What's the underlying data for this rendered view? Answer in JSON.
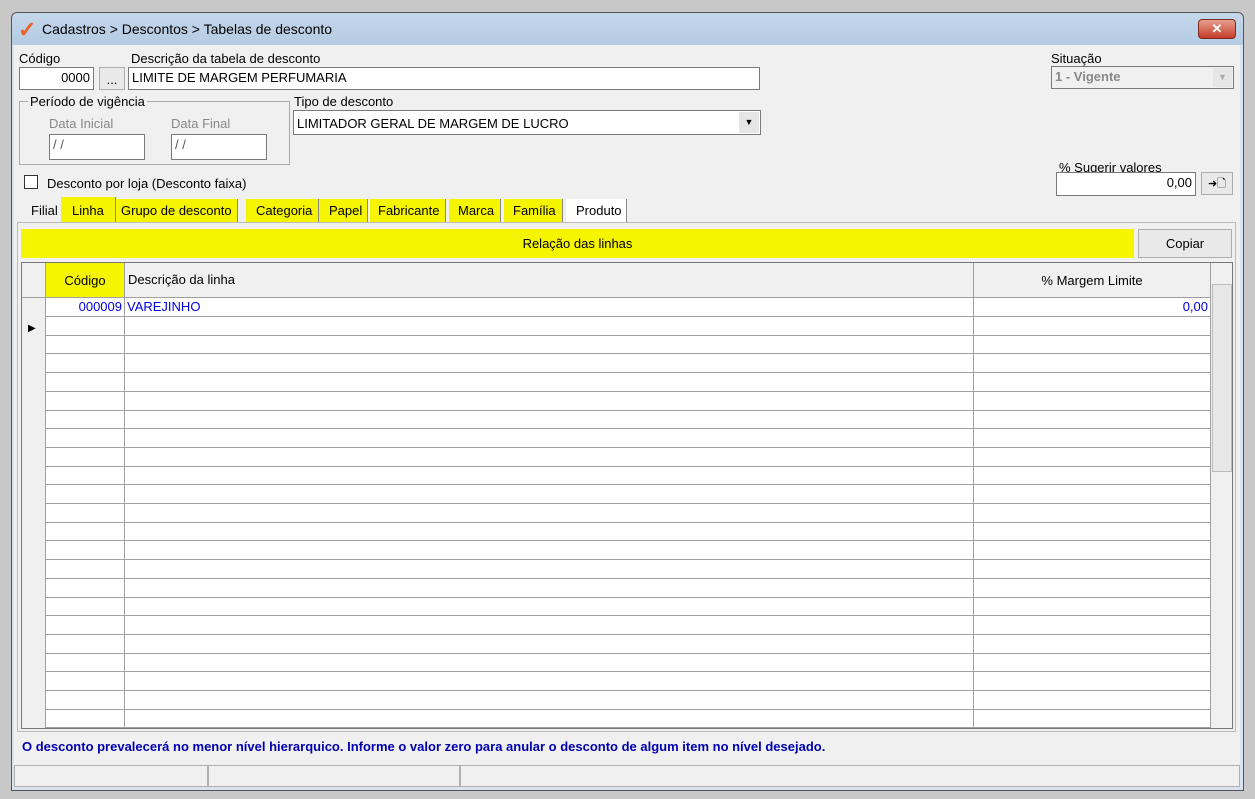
{
  "window": {
    "title": "Cadastros > Descontos > Tabelas de desconto",
    "close": "✕"
  },
  "form": {
    "codigo_label": "Código",
    "codigo_value": "0000",
    "lookup_button": "...",
    "descricao_label": "Descrição da tabela de desconto",
    "descricao_value": "LIMITE DE MARGEM PERFUMARIA",
    "situacao_label": "Situação",
    "situacao_value": "1 - Vigente",
    "periodo_label": "Período de vigência",
    "data_inicial_label": "Data Inicial",
    "data_inicial_value": " / /",
    "data_final_label": "Data Final",
    "data_final_value": " / /",
    "tipo_label": "Tipo de desconto",
    "tipo_value": "LIMITADOR GERAL DE MARGEM DE LUCRO",
    "desconto_loja_label": "Desconto por loja (Desconto faixa)",
    "sugerir_label": "% Sugerir valores",
    "sugerir_value": "0,00",
    "apply_button": "➜🗋"
  },
  "tabs": [
    "Filial",
    "Linha",
    "Grupo de desconto",
    "Categoria",
    "Papel",
    "Fabricante",
    "Marca",
    "Família",
    "Produto"
  ],
  "panel": {
    "title": "Relação das linhas",
    "copy_button": "Copiar"
  },
  "grid": {
    "columns": [
      "Código",
      "Descrição da linha",
      "% Margem Limite"
    ],
    "rows": [
      {
        "codigo": "000009",
        "descricao": "VAREJINHO",
        "margem": "0,00"
      }
    ]
  },
  "status_message": "O desconto prevalecerá no menor nível hierarquico. Informe o valor zero para anular o desconto de algum item no nível desejado.",
  "colors": {
    "highlight": "#f5f500",
    "link_blue": "#0000e0"
  }
}
